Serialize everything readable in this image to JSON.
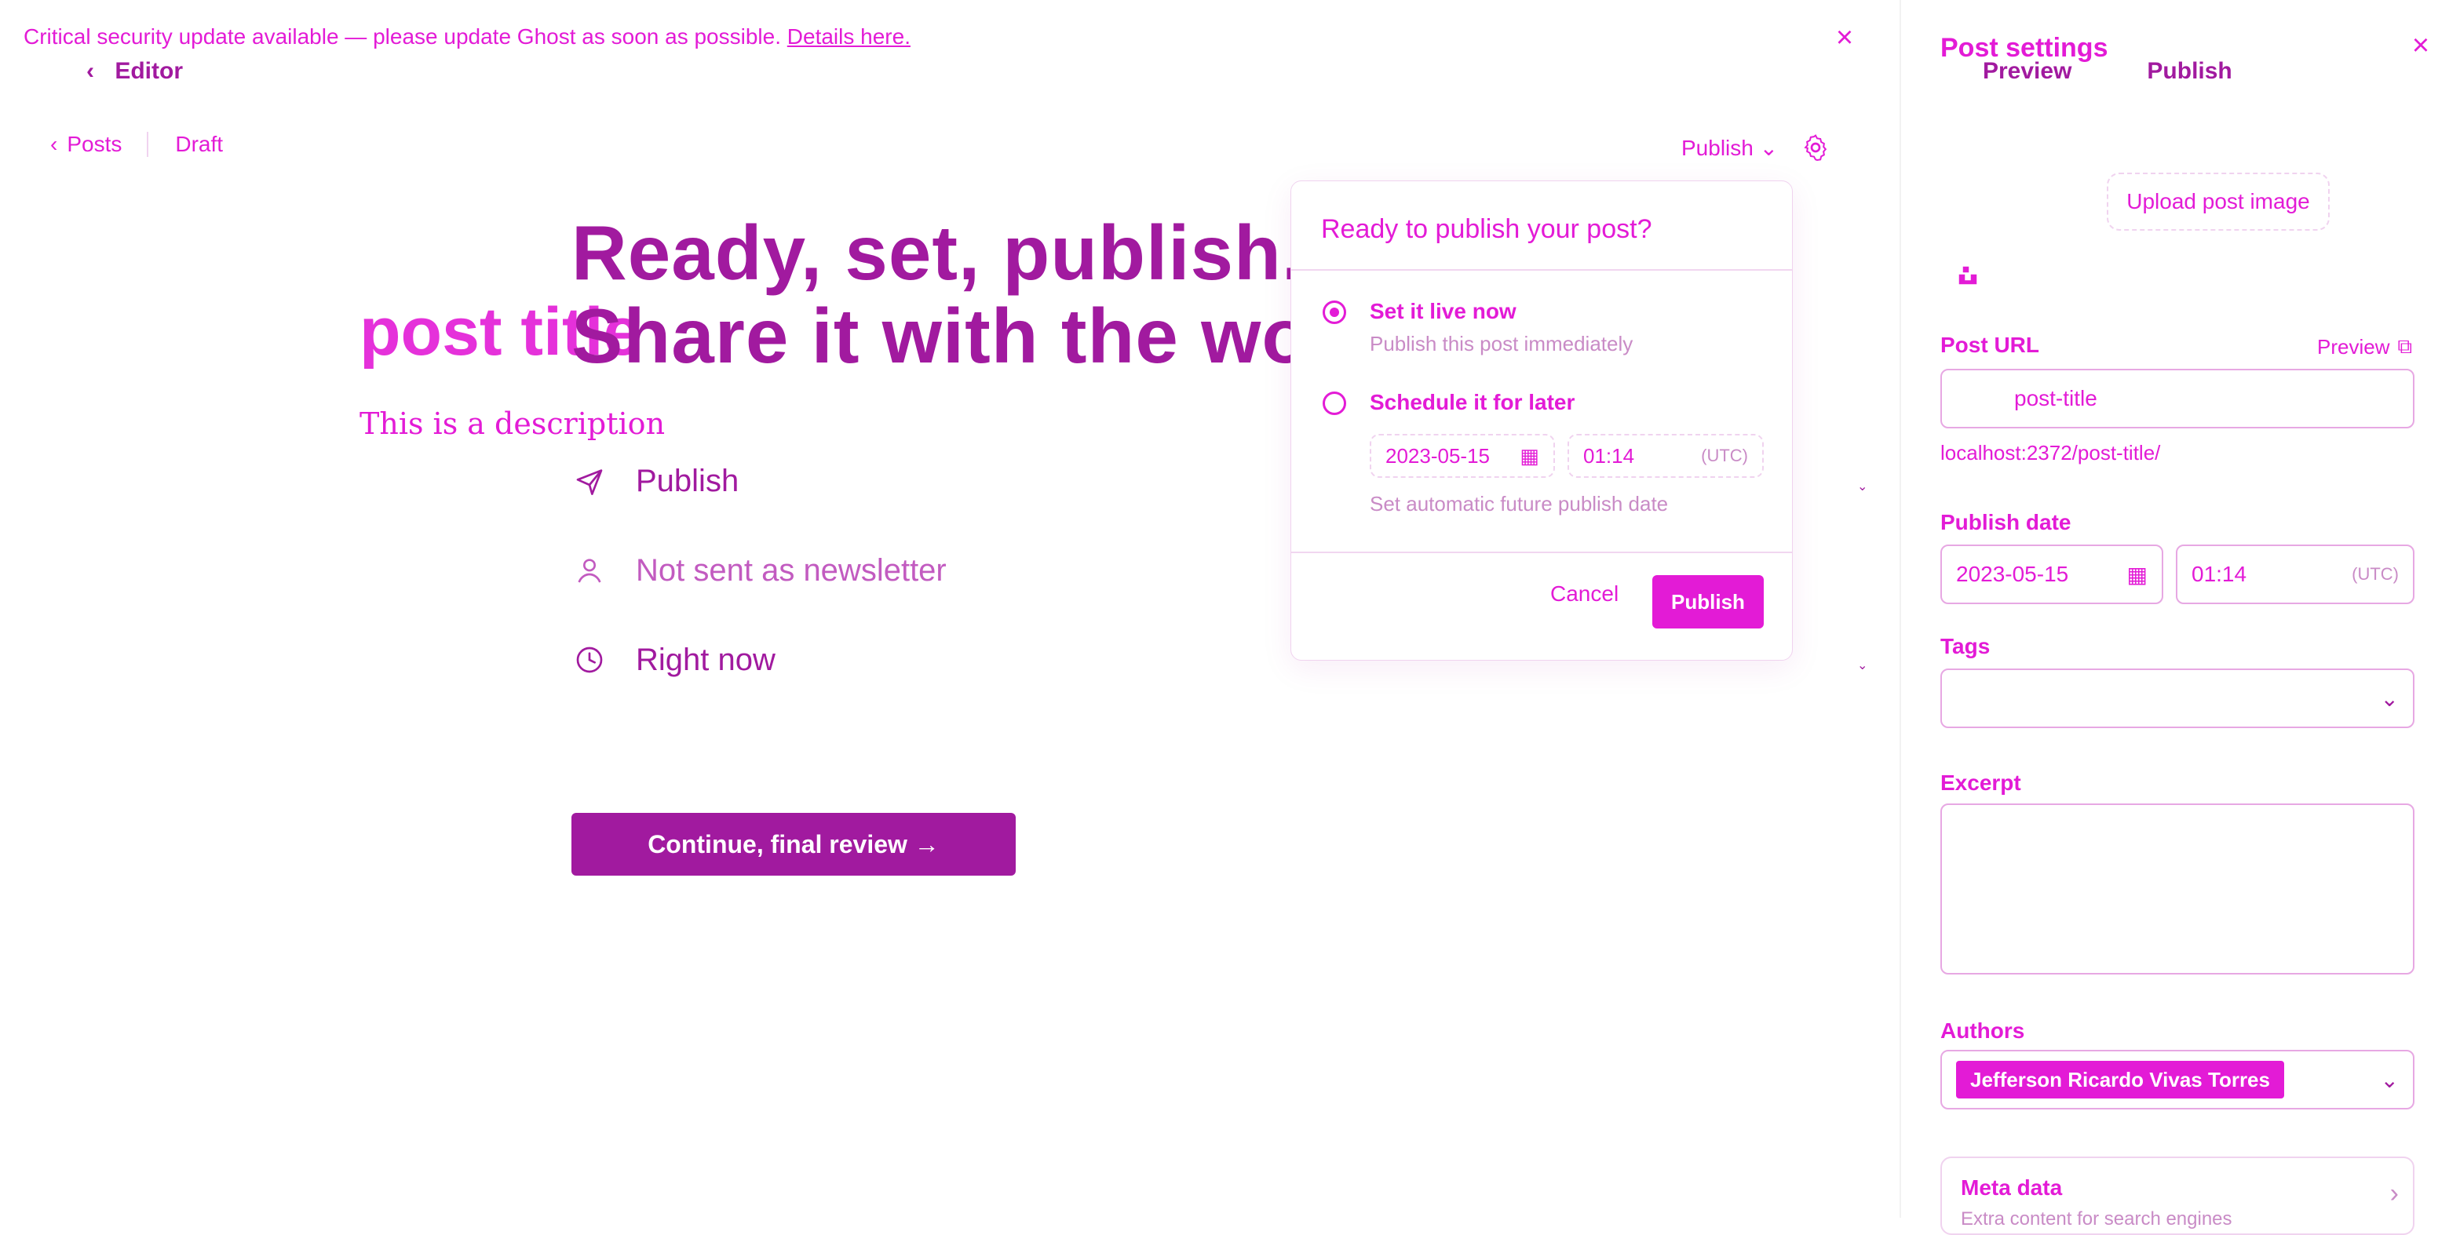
{
  "banner": {
    "text": "Critical security update available — please update Ghost as soon as possible.",
    "link": "Details here."
  },
  "editor": {
    "back_label": "Editor",
    "crumbs": {
      "posts": "Posts",
      "draft": "Draft"
    },
    "top_publish": "Publish",
    "headline_line1": "Ready, set, publish.",
    "headline_line2": "Share it with the world.",
    "post_title": "post title",
    "description": "This is a description",
    "rows": {
      "publish": "Publish",
      "newsletter": "Not sent as newsletter",
      "time": "Right now"
    },
    "continue_btn": "Continue, final review →"
  },
  "popover": {
    "title": "Ready to publish your post?",
    "opt1": {
      "label": "Set it live now",
      "sub": "Publish this post immediately"
    },
    "opt2": {
      "label": "Schedule it for later"
    },
    "date": "2023-05-15",
    "time": "01:14",
    "tz": "(UTC)",
    "hint": "Set automatic future publish date",
    "cancel": "Cancel",
    "publish": "Publish"
  },
  "sidebar": {
    "title": "Post settings",
    "tabs": [
      "Preview",
      "Publish"
    ],
    "upload": "Upload post image",
    "url_label": "Post URL",
    "url_preview": "Preview",
    "url_value": "post-title",
    "url_hint": "localhost:2372/post-title/",
    "date_label": "Publish date",
    "date_value": "2023-05-15",
    "time_value": "01:14",
    "time_tz": "(UTC)",
    "tags_label": "Tags",
    "excerpt_label": "Excerpt",
    "authors_label": "Authors",
    "author_name": "Jefferson Ricardo Vivas Torres",
    "meta_title": "Meta data",
    "meta_sub": "Extra content for search engines"
  },
  "colors": {
    "accent": "#e31bd6",
    "accent_dark": "#a11a9f",
    "border": "#e7a8e3",
    "muted": "#c98bc6"
  },
  "icons": {
    "banner_close": "close-icon",
    "back": "chevron-left-icon",
    "gear": "gear-icon",
    "publish_row": "send-icon",
    "newsletter_row": "user-icon",
    "time_row": "clock-icon",
    "calendar": "calendar-icon",
    "external": "external-link-icon",
    "unsplash": "unsplash-icon",
    "dropdown": "chevron-down-icon",
    "meta_arrow": "chevron-right-icon"
  }
}
